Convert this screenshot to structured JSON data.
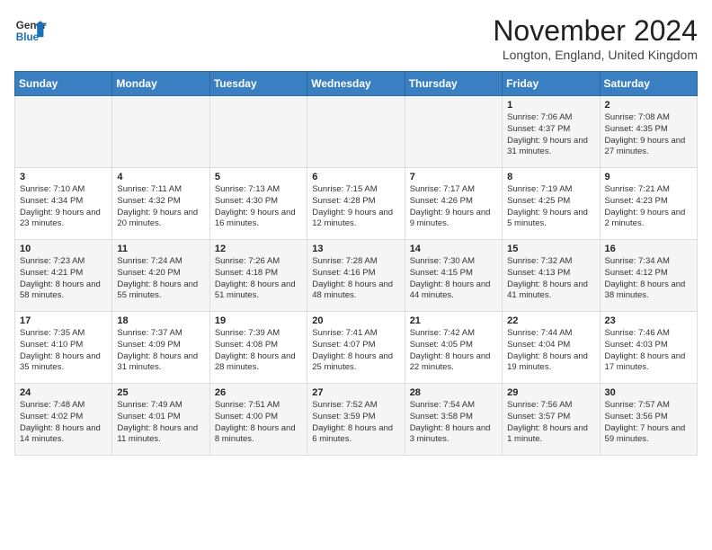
{
  "logo": {
    "general": "General",
    "blue": "Blue"
  },
  "title": "November 2024",
  "location": "Longton, England, United Kingdom",
  "days_of_week": [
    "Sunday",
    "Monday",
    "Tuesday",
    "Wednesday",
    "Thursday",
    "Friday",
    "Saturday"
  ],
  "weeks": [
    [
      {
        "day": "",
        "info": ""
      },
      {
        "day": "",
        "info": ""
      },
      {
        "day": "",
        "info": ""
      },
      {
        "day": "",
        "info": ""
      },
      {
        "day": "",
        "info": ""
      },
      {
        "day": "1",
        "info": "Sunrise: 7:06 AM\nSunset: 4:37 PM\nDaylight: 9 hours and 31 minutes."
      },
      {
        "day": "2",
        "info": "Sunrise: 7:08 AM\nSunset: 4:35 PM\nDaylight: 9 hours and 27 minutes."
      }
    ],
    [
      {
        "day": "3",
        "info": "Sunrise: 7:10 AM\nSunset: 4:34 PM\nDaylight: 9 hours and 23 minutes."
      },
      {
        "day": "4",
        "info": "Sunrise: 7:11 AM\nSunset: 4:32 PM\nDaylight: 9 hours and 20 minutes."
      },
      {
        "day": "5",
        "info": "Sunrise: 7:13 AM\nSunset: 4:30 PM\nDaylight: 9 hours and 16 minutes."
      },
      {
        "day": "6",
        "info": "Sunrise: 7:15 AM\nSunset: 4:28 PM\nDaylight: 9 hours and 12 minutes."
      },
      {
        "day": "7",
        "info": "Sunrise: 7:17 AM\nSunset: 4:26 PM\nDaylight: 9 hours and 9 minutes."
      },
      {
        "day": "8",
        "info": "Sunrise: 7:19 AM\nSunset: 4:25 PM\nDaylight: 9 hours and 5 minutes."
      },
      {
        "day": "9",
        "info": "Sunrise: 7:21 AM\nSunset: 4:23 PM\nDaylight: 9 hours and 2 minutes."
      }
    ],
    [
      {
        "day": "10",
        "info": "Sunrise: 7:23 AM\nSunset: 4:21 PM\nDaylight: 8 hours and 58 minutes."
      },
      {
        "day": "11",
        "info": "Sunrise: 7:24 AM\nSunset: 4:20 PM\nDaylight: 8 hours and 55 minutes."
      },
      {
        "day": "12",
        "info": "Sunrise: 7:26 AM\nSunset: 4:18 PM\nDaylight: 8 hours and 51 minutes."
      },
      {
        "day": "13",
        "info": "Sunrise: 7:28 AM\nSunset: 4:16 PM\nDaylight: 8 hours and 48 minutes."
      },
      {
        "day": "14",
        "info": "Sunrise: 7:30 AM\nSunset: 4:15 PM\nDaylight: 8 hours and 44 minutes."
      },
      {
        "day": "15",
        "info": "Sunrise: 7:32 AM\nSunset: 4:13 PM\nDaylight: 8 hours and 41 minutes."
      },
      {
        "day": "16",
        "info": "Sunrise: 7:34 AM\nSunset: 4:12 PM\nDaylight: 8 hours and 38 minutes."
      }
    ],
    [
      {
        "day": "17",
        "info": "Sunrise: 7:35 AM\nSunset: 4:10 PM\nDaylight: 8 hours and 35 minutes."
      },
      {
        "day": "18",
        "info": "Sunrise: 7:37 AM\nSunset: 4:09 PM\nDaylight: 8 hours and 31 minutes."
      },
      {
        "day": "19",
        "info": "Sunrise: 7:39 AM\nSunset: 4:08 PM\nDaylight: 8 hours and 28 minutes."
      },
      {
        "day": "20",
        "info": "Sunrise: 7:41 AM\nSunset: 4:07 PM\nDaylight: 8 hours and 25 minutes."
      },
      {
        "day": "21",
        "info": "Sunrise: 7:42 AM\nSunset: 4:05 PM\nDaylight: 8 hours and 22 minutes."
      },
      {
        "day": "22",
        "info": "Sunrise: 7:44 AM\nSunset: 4:04 PM\nDaylight: 8 hours and 19 minutes."
      },
      {
        "day": "23",
        "info": "Sunrise: 7:46 AM\nSunset: 4:03 PM\nDaylight: 8 hours and 17 minutes."
      }
    ],
    [
      {
        "day": "24",
        "info": "Sunrise: 7:48 AM\nSunset: 4:02 PM\nDaylight: 8 hours and 14 minutes."
      },
      {
        "day": "25",
        "info": "Sunrise: 7:49 AM\nSunset: 4:01 PM\nDaylight: 8 hours and 11 minutes."
      },
      {
        "day": "26",
        "info": "Sunrise: 7:51 AM\nSunset: 4:00 PM\nDaylight: 8 hours and 8 minutes."
      },
      {
        "day": "27",
        "info": "Sunrise: 7:52 AM\nSunset: 3:59 PM\nDaylight: 8 hours and 6 minutes."
      },
      {
        "day": "28",
        "info": "Sunrise: 7:54 AM\nSunset: 3:58 PM\nDaylight: 8 hours and 3 minutes."
      },
      {
        "day": "29",
        "info": "Sunrise: 7:56 AM\nSunset: 3:57 PM\nDaylight: 8 hours and 1 minute."
      },
      {
        "day": "30",
        "info": "Sunrise: 7:57 AM\nSunset: 3:56 PM\nDaylight: 7 hours and 59 minutes."
      }
    ]
  ]
}
